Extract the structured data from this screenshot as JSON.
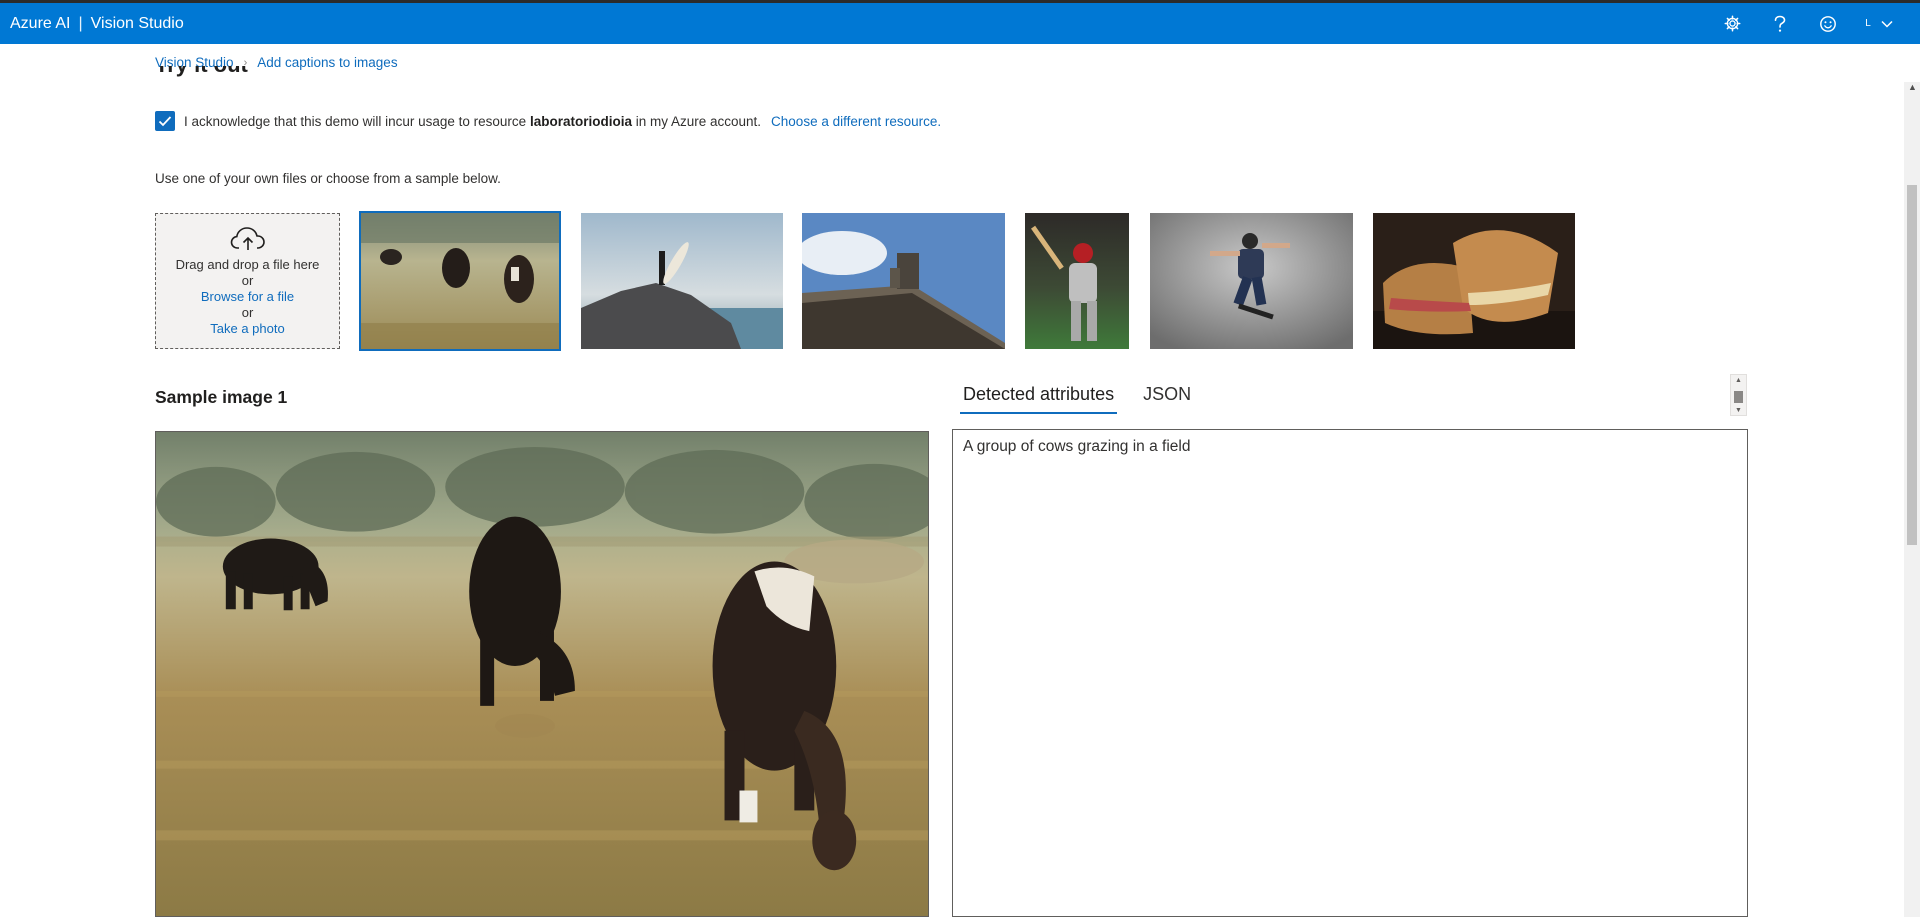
{
  "app": {
    "brand": "Azure AI",
    "product": "Vision Studio",
    "icons": [
      "gear-icon",
      "help-icon",
      "feedback-smiley-icon",
      "chevron-down-icon"
    ],
    "account_initial": "L",
    "accent_color": "#0078d4"
  },
  "breadcrumb": {
    "root": "Vision Studio",
    "current": "Add captions to images"
  },
  "section": {
    "heading": "Try it out"
  },
  "acknowledge": {
    "checked": true,
    "text_before": "I acknowledge that this demo will incur usage to resource",
    "resource": "laboratoriodioia",
    "text_after": "in my Azure account.",
    "link": "Choose a different resource."
  },
  "upload": {
    "hint": "Use one of your own files or choose from a sample below.",
    "drag_text": "Drag and drop a file here",
    "or1": "or",
    "browse": "Browse for a file",
    "or2": "or",
    "photo": "Take a photo"
  },
  "samples": [
    {
      "name": "cows-grazing",
      "selected": true
    },
    {
      "name": "surfer-on-rock",
      "selected": false
    },
    {
      "name": "building-statues",
      "selected": false
    },
    {
      "name": "baseball-batter",
      "selected": false
    },
    {
      "name": "skateboarder",
      "selected": false
    },
    {
      "name": "grilled-sandwich",
      "selected": false
    }
  ],
  "preview": {
    "title": "Sample image 1"
  },
  "tabs": {
    "detected": "Detected attributes",
    "json": "JSON",
    "active": "detected"
  },
  "result": {
    "caption": "A group of cows grazing in a field"
  }
}
